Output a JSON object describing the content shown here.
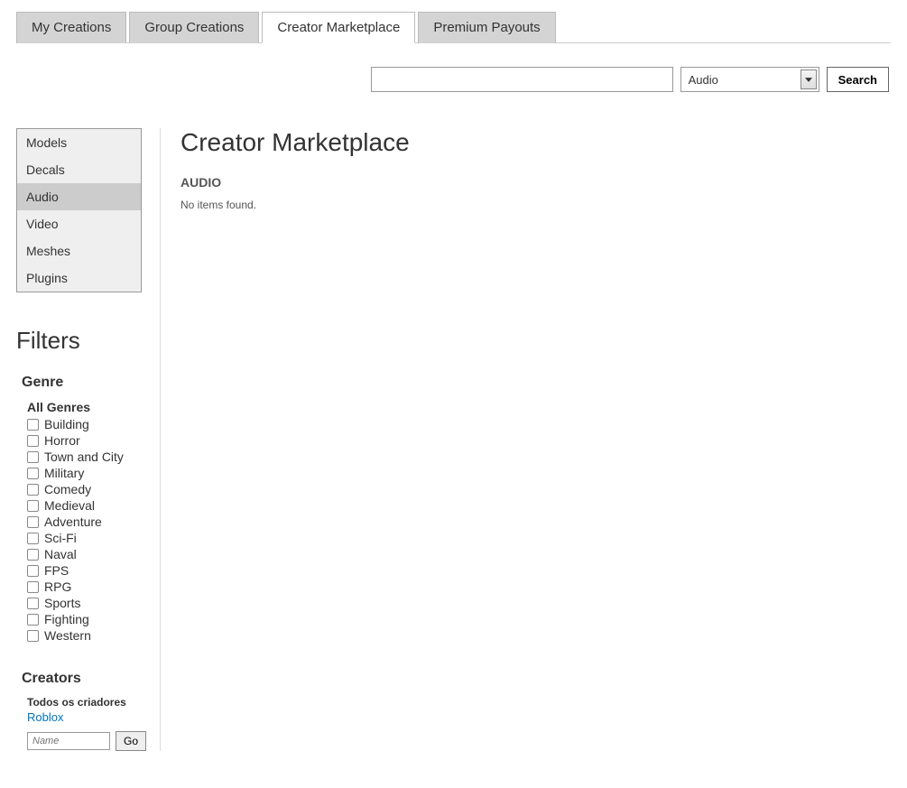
{
  "tabs": [
    {
      "label": "My Creations"
    },
    {
      "label": "Group Creations"
    },
    {
      "label": "Creator Marketplace"
    },
    {
      "label": "Premium Payouts"
    }
  ],
  "active_tab_index": 2,
  "search": {
    "input_value": "",
    "select_value": "Audio",
    "button_label": "Search"
  },
  "sidebar": {
    "categories": [
      {
        "label": "Models"
      },
      {
        "label": "Decals"
      },
      {
        "label": "Audio"
      },
      {
        "label": "Video"
      },
      {
        "label": "Meshes"
      },
      {
        "label": "Plugins"
      }
    ],
    "active_category_index": 2,
    "filters_title": "Filters",
    "genre_title": "Genre",
    "all_genres_label": "All Genres",
    "genres": [
      "Building",
      "Horror",
      "Town and City",
      "Military",
      "Comedy",
      "Medieval",
      "Adventure",
      "Sci-Fi",
      "Naval",
      "FPS",
      "RPG",
      "Sports",
      "Fighting",
      "Western"
    ],
    "creators_title": "Creators",
    "creators_sub": "Todos os criadores",
    "creators_link": "Roblox",
    "creators_input_placeholder": "Name",
    "creators_go_label": "Go"
  },
  "main": {
    "title": "Creator Marketplace",
    "section_heading": "AUDIO",
    "empty_message": "No items found."
  }
}
